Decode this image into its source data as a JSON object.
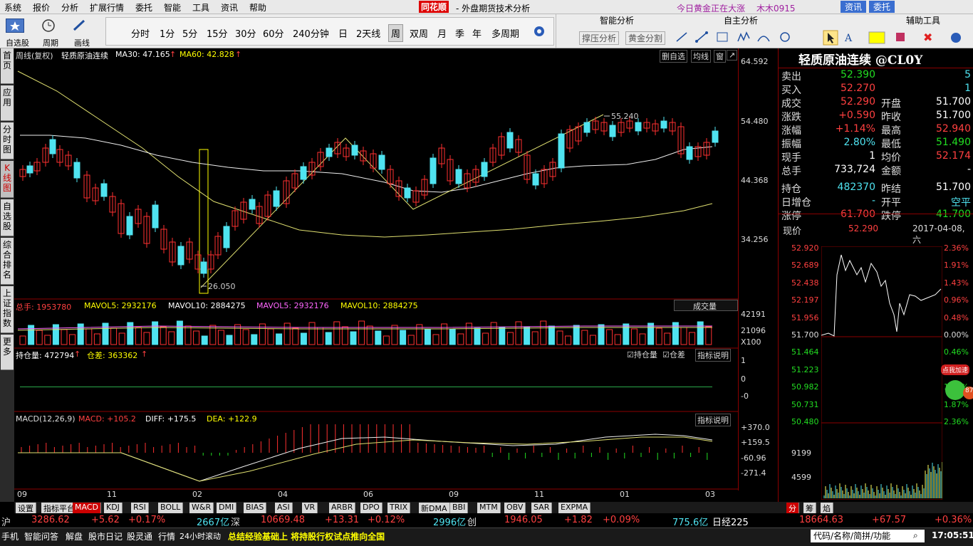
{
  "menu": {
    "items": [
      "系统",
      "报价",
      "分析",
      "扩展行情",
      "委托",
      "智能",
      "工具",
      "资讯",
      "帮助"
    ],
    "brand": "同花顺",
    "title": "- 外盘期货技术分析",
    "news": "今日黄金正在大涨",
    "user": "木木0915",
    "btn_zixun": "资讯",
    "btn_weituo": "委托"
  },
  "toolbar": {
    "left": [
      "自选股",
      "周期",
      "画线"
    ],
    "periods": [
      "分时",
      "1分",
      "5分",
      "15分",
      "30分",
      "60分",
      "240分钟",
      "日",
      "2天线",
      "周",
      "双周",
      "月",
      "季",
      "年",
      "多周期"
    ],
    "active": "周",
    "smart_title": "智能分析",
    "smart_btns": [
      "撑压分析",
      "黄金分割"
    ],
    "self_title": "自主分析",
    "aux_title": "辅助工具"
  },
  "lefttabs": [
    "首页",
    "应用",
    "分时图",
    "K线图",
    "自选股",
    "综合排名",
    "上证指数",
    "更多"
  ],
  "chart": {
    "header": "周线(复权)",
    "name": "轻质原油连续",
    "ma30": "MA30: 47.165",
    "ma60": "MA60: 42.828",
    "tabs": [
      "删自选",
      "均线",
      "窗"
    ],
    "price_labels": [
      "64.592",
      "54.480",
      "44.368",
      "34.256"
    ],
    "hi_label": "55.240",
    "lo_label": "26.050",
    "vol_header": {
      "total": "总手: 1953780",
      "mavol5": "MAVOL5: 2932176",
      "mavol10": "MAVOL10: 2884275",
      "mavol5b": "MAVOL5: 2932176",
      "mavol10b": "MAVOL10: 2884275"
    },
    "vol_btn": "成交量",
    "vol_labels": [
      "42191",
      "21096",
      "X100"
    ],
    "oi_header": {
      "oi": "持仓量: 472794",
      "diff": "仓差: 363362"
    },
    "oi_checks": [
      "持仓量",
      "仓差"
    ],
    "oi_btn": "指标说明",
    "oi_labels": [
      "1",
      "0",
      "-0"
    ],
    "macd_header": {
      "name": "MACD(12,26,9)",
      "macd": "MACD: +105.2",
      "diff": "DIFF: +175.5",
      "dea": "DEA: +122.9"
    },
    "macd_btn": "指标说明",
    "macd_labels": [
      "+370.0",
      "+159.5",
      "-60.96",
      "-271.4"
    ],
    "months": [
      "09",
      "11",
      "02",
      "04",
      "06",
      "09",
      "11",
      "01",
      "03"
    ]
  },
  "bottomtabs": [
    "设置",
    "指标平台",
    "MACD",
    "KDJ",
    "RSI",
    "BOLL",
    "W&R",
    "DMI",
    "BIAS",
    "ASI",
    "VR",
    "ARBR",
    "DPO",
    "TRIX",
    "新DMA",
    "BBI",
    "MTM",
    "OBV",
    "SAR",
    "EXPMA"
  ],
  "quote": {
    "title": "轻质原油连续 @CL0Y",
    "rows": [
      [
        "卖出",
        "52.390",
        "",
        "5"
      ],
      [
        "买入",
        "52.270",
        "",
        "1"
      ],
      [
        "成交",
        "52.290",
        "开盘",
        "51.700"
      ],
      [
        "涨跌",
        "+0.590",
        "昨收",
        "51.700"
      ],
      [
        "涨幅",
        "+1.14%",
        "最高",
        "52.940"
      ],
      [
        "振幅",
        "2.80%",
        "最低",
        "51.490"
      ],
      [
        "现手",
        "1",
        "均价",
        "52.174"
      ],
      [
        "总手",
        "733,724",
        "金额",
        "-"
      ],
      [
        "持仓",
        "482370",
        "昨结",
        "51.700"
      ],
      [
        "日增仓",
        "-",
        "开平",
        "空平"
      ],
      [
        "涨停",
        "61.700",
        "跌停",
        "41.700"
      ]
    ],
    "now_label": "现价",
    "now_price": "52.290",
    "date": "2017-04-08,六",
    "mini_left": [
      "52.920",
      "52.689",
      "52.438",
      "52.197",
      "51.956",
      "51.700",
      "51.464",
      "51.223",
      "50.982",
      "50.731",
      "50.480",
      "9199",
      "4599"
    ],
    "mini_right": [
      "2.36%",
      "1.91%",
      "1.43%",
      "0.96%",
      "0.48%",
      "0.00%",
      "0.46%",
      "0.96%",
      "1.43%",
      "1.87%",
      "2.36%"
    ],
    "badge": "点我加速",
    "badge_num": "87",
    "tabs": [
      "分",
      "筹",
      "焰"
    ]
  },
  "ticker": {
    "sh_label": "沪",
    "sh": "3286.62",
    "sh_chg": "+5.62",
    "sh_pct": "+0.17%",
    "sh_amt": "2667亿",
    "sz_label": "深",
    "sz": "10669.48",
    "sz_chg": "+13.31",
    "sz_pct": "+0.12%",
    "sz_amt": "2996亿",
    "cy_label": "创",
    "cy": "1946.05",
    "cy_chg": "+1.82",
    "cy_pct": "+0.09%",
    "cy_amt": "775.6亿",
    "nk_label": "日经225",
    "nk": "18664.63",
    "nk_chg": "+67.57",
    "nk_pct": "+0.36%"
  },
  "status": {
    "items": [
      "手机",
      "智能问答",
      "解盘",
      "股市日记",
      "股灵通",
      "行情",
      "24小时滚动"
    ],
    "news": "总结经验基础上 将持股行权试点推向全国",
    "search": "代码/名称/简拼/功能",
    "time": "17:05:51"
  }
}
